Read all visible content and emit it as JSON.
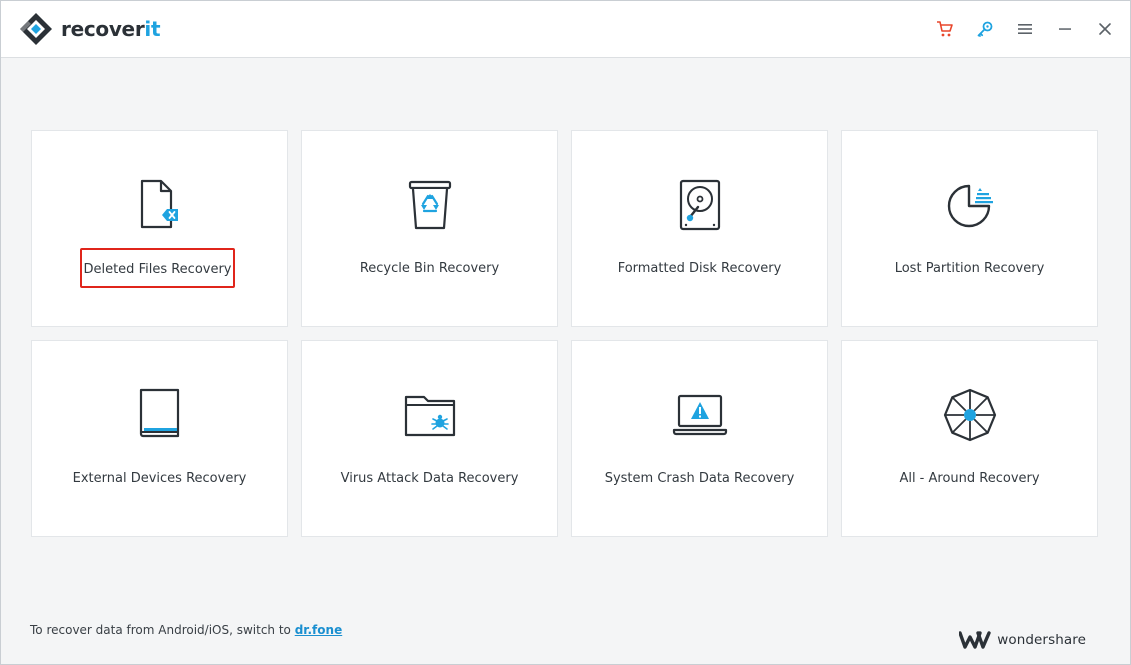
{
  "app": {
    "logo_text_main": "recover",
    "logo_text_accent": "it"
  },
  "titlebar": {
    "icons": [
      "cart-icon",
      "key-icon",
      "menu-icon",
      "minimize-icon",
      "close-icon"
    ],
    "accent_colors": {
      "cart": "#e8462b",
      "key": "#1fa3e0",
      "neutral": "#5b6268"
    }
  },
  "cards": [
    {
      "label": "Deleted Files Recovery",
      "icon": "deleted-file-icon",
      "selected": true
    },
    {
      "label": "Recycle Bin Recovery",
      "icon": "recycle-bin-icon"
    },
    {
      "label": "Formatted Disk Recovery",
      "icon": "hard-disk-icon"
    },
    {
      "label": "Lost Partition Recovery",
      "icon": "partition-pie-icon"
    },
    {
      "label": "External Devices Recovery",
      "icon": "external-drive-icon"
    },
    {
      "label": "Virus Attack Data Recovery",
      "icon": "virus-folder-icon"
    },
    {
      "label": "System Crash Data Recovery",
      "icon": "crashed-laptop-icon"
    },
    {
      "label": "All - Around Recovery",
      "icon": "all-around-icon"
    }
  ],
  "footer": {
    "note": "To recover data from Android/iOS, switch to ",
    "link": "dr.fone",
    "brand": "wondershare"
  },
  "colors": {
    "accent_blue": "#1fa3e0",
    "selection_red": "#e0251b",
    "icon_dark": "#2b3137"
  }
}
